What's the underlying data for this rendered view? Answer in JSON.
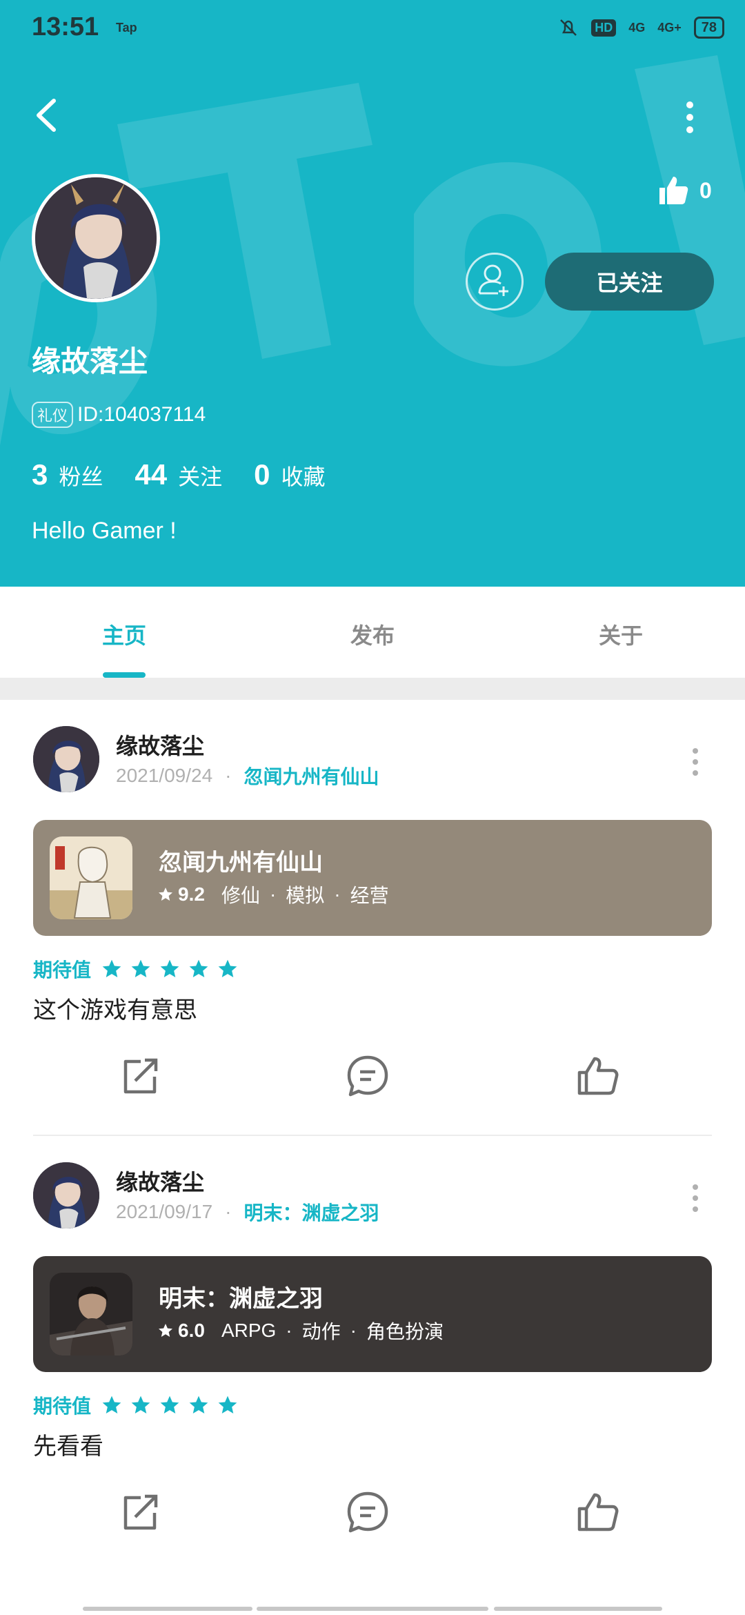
{
  "status_bar": {
    "time": "13:51",
    "left_icons": "Tap",
    "battery": "78",
    "network1": "4G",
    "network2": "4G+",
    "hd": "HD"
  },
  "profile": {
    "username": "缘故落尘",
    "tag": "礼仪",
    "id_text": "ID:104037114",
    "likes": "0",
    "follow_label": "已关注",
    "bio": "Hello Gamer !",
    "stats": [
      {
        "num": "3",
        "label": "粉丝"
      },
      {
        "num": "44",
        "label": "关注"
      },
      {
        "num": "0",
        "label": "收藏"
      }
    ]
  },
  "tabs": [
    "主页",
    "发布",
    "关于"
  ],
  "posts": [
    {
      "author": "缘故落尘",
      "date": "2021/09/24",
      "dot": "·",
      "game_link": "忽闻九州有仙山",
      "game": {
        "title": "忽闻九州有仙山",
        "score": "9.2",
        "tags": [
          "修仙",
          "模拟",
          "经营"
        ],
        "card_color": "#94897a"
      },
      "expect_label": "期待值",
      "stars": 5,
      "review": "这个游戏有意思"
    },
    {
      "author": "缘故落尘",
      "date": "2021/09/17",
      "dot": "·",
      "game_link": "明末：渊虚之羽",
      "game": {
        "title": "明末：渊虚之羽",
        "score": "6.0",
        "tags": [
          "ARPG",
          "动作",
          "角色扮演"
        ],
        "card_color": "#3b3736"
      },
      "expect_label": "期待值",
      "stars": 5,
      "review": "先看看"
    }
  ],
  "colors": {
    "accent": "#17b6c6",
    "follow_button": "#1e6c75"
  },
  "icons": [
    "back-arrow-icon",
    "more-vertical-icon",
    "thumb-up-icon",
    "add-friend-icon",
    "star-icon",
    "share-icon",
    "comment-icon",
    "like-icon"
  ]
}
